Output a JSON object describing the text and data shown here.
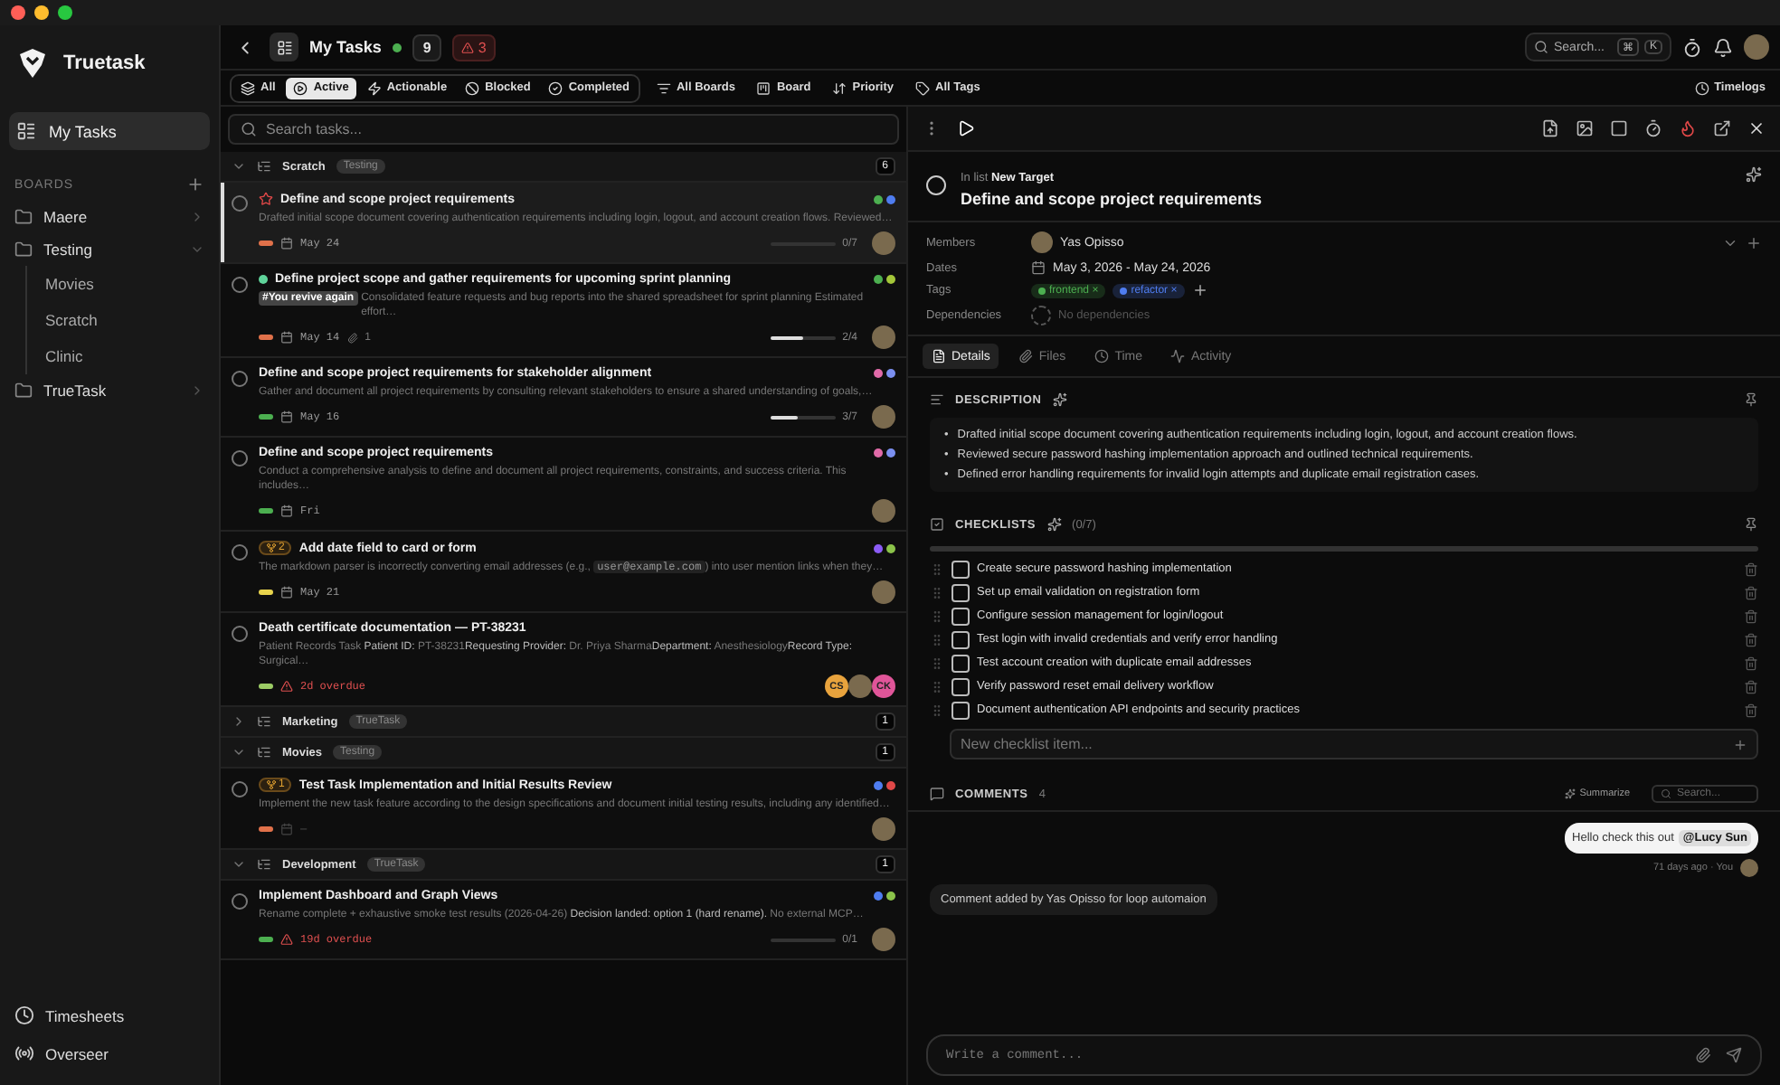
{
  "sidebar": {
    "brand": "Truetask",
    "nav": [
      {
        "label": "My Tasks",
        "selected": true
      }
    ],
    "boards_label": "BOARDS",
    "boards": [
      {
        "label": "Maere",
        "expanded": false
      },
      {
        "label": "Testing",
        "expanded": true,
        "children": [
          {
            "label": "Movies"
          },
          {
            "label": "Scratch"
          },
          {
            "label": "Clinic"
          }
        ]
      },
      {
        "label": "TrueTask",
        "expanded": false
      }
    ],
    "footer": [
      {
        "kind": "timesheets",
        "label": "Timesheets"
      },
      {
        "kind": "overseer",
        "label": "Overseer"
      }
    ]
  },
  "header": {
    "title": "My Tasks",
    "active_count": "9",
    "alert_count": "3",
    "search_placeholder": "Search...",
    "shortcut": [
      "⌘",
      "K"
    ]
  },
  "filters": [
    {
      "kind": "all",
      "label": "All",
      "selected": false
    },
    {
      "kind": "active",
      "label": "Active",
      "selected": true
    },
    {
      "kind": "actionable",
      "label": "Actionable",
      "selected": false
    },
    {
      "kind": "blocked",
      "label": "Blocked",
      "selected": false
    },
    {
      "kind": "completed",
      "label": "Completed",
      "selected": false
    }
  ],
  "views": [
    {
      "kind": "boards",
      "label": "All Boards"
    },
    {
      "kind": "board",
      "label": "Board"
    },
    {
      "kind": "priority",
      "label": "Priority"
    },
    {
      "kind": "tags",
      "label": "All Tags"
    }
  ],
  "timelogs": "Timelogs",
  "task_search": {
    "placeholder": "Search tasks..."
  },
  "groups": [
    {
      "name": "Scratch",
      "board": "Testing",
      "count": "6",
      "expanded": true,
      "tasks": [
        {
          "title": "Define and scope project requirements",
          "completed": false,
          "flagged": true,
          "selected": true,
          "description": [
            {
              "kind": "text",
              "text": "Drafted initial scope document covering authentication requirements including login, logout, and account creation flows. Reviewed…"
            }
          ],
          "priority": {
            "color": "#e0714a"
          },
          "due": {
            "kind": "date",
            "text": "May 24"
          },
          "progress": {
            "level": 0,
            "reading": "0/7"
          },
          "dots": [
            {
              "color": "#4caf50"
            },
            {
              "color": "#4f7df0"
            }
          ],
          "assignees": [
            {
              "kind": "photo"
            }
          ]
        },
        {
          "title": "Define project scope and gather requirements for upcoming sprint planning",
          "completed": false,
          "flagged": false,
          "selected": false,
          "status": {
            "color": "#5fd39a"
          },
          "label": "#You revive again",
          "description": [
            {
              "kind": "text",
              "text": "Consolidated feature requests and bug reports into the shared spreadsheet for sprint planning Estimated effort…"
            }
          ],
          "priority": {
            "color": "#e0714a"
          },
          "due": {
            "kind": "date",
            "text": "May 14"
          },
          "attachments": "1",
          "progress": {
            "level": 0.5,
            "reading": "2/4"
          },
          "dots": [
            {
              "color": "#4caf50"
            },
            {
              "color": "#a4c639"
            }
          ],
          "assignees": [
            {
              "kind": "photo"
            }
          ]
        },
        {
          "title": "Define and scope project requirements for stakeholder alignment",
          "completed": false,
          "flagged": false,
          "selected": false,
          "description": [
            {
              "kind": "text",
              "text": "Gather and document all project requirements by consulting relevant stakeholders to ensure a shared understanding of goals,…"
            }
          ],
          "priority": {
            "color": "#4caf50"
          },
          "due": {
            "kind": "date",
            "text": "May 16"
          },
          "progress": {
            "level": 0.43,
            "reading": "3/7"
          },
          "dots": [
            {
              "color": "#e06aa8"
            },
            {
              "color": "#7b8ff0"
            }
          ],
          "assignees": [
            {
              "kind": "photo"
            }
          ]
        },
        {
          "title": "Define and scope project requirements",
          "completed": false,
          "flagged": false,
          "selected": false,
          "description": [
            {
              "kind": "text",
              "text": "Conduct a comprehensive analysis to define and document all project requirements, constraints, and success criteria. This includes…"
            }
          ],
          "priority": {
            "color": "#4caf50"
          },
          "due": {
            "kind": "date",
            "text": "Fri"
          },
          "dots": [
            {
              "color": "#e06aa8"
            },
            {
              "color": "#7b8ff0"
            }
          ],
          "assignees": [
            {
              "kind": "photo"
            }
          ]
        },
        {
          "title": "Add date field to card or form",
          "completed": false,
          "flagged": false,
          "selected": false,
          "subtasks": "2",
          "description": [
            {
              "kind": "text",
              "text": "The markdown parser is incorrectly converting email addresses (e.g., "
            },
            {
              "kind": "code",
              "text": "user@example.com"
            },
            {
              "kind": "text",
              "text": ") into user mention links when they…"
            }
          ],
          "priority": {
            "color": "#e8d44d"
          },
          "due": {
            "kind": "date",
            "text": "May 21"
          },
          "dots": [
            {
              "color": "#8b5cf6"
            },
            {
              "color": "#8bc34a"
            }
          ],
          "assignees": [
            {
              "kind": "photo"
            }
          ]
        },
        {
          "title": "Death certificate documentation — PT-38231",
          "completed": false,
          "flagged": false,
          "selected": false,
          "description": [
            {
              "kind": "text",
              "text": "Patient Records Task **Patient ID:** PT-38231**Requesting Provider:** Dr. Priya Sharma**Department:** Anesthesiology**Record Type:** Surgical…"
            }
          ],
          "priority": {
            "color": "#9ccc65"
          },
          "due": {
            "kind": "overdue",
            "text": "2d overdue"
          },
          "assignees": [
            {
              "kind": "initials",
              "initials": "CS",
              "color": "#e8a33d"
            },
            {
              "kind": "photo"
            },
            {
              "kind": "initials",
              "initials": "CK",
              "color": "#e05599"
            }
          ]
        }
      ]
    },
    {
      "name": "Marketing",
      "board": "TrueTask",
      "count": "1",
      "expanded": false
    },
    {
      "name": "Movies",
      "board": "Testing",
      "count": "1",
      "expanded": true,
      "tasks": [
        {
          "title": "Test Task Implementation and Initial Results Review",
          "completed": false,
          "flagged": false,
          "selected": false,
          "subtasks": "1",
          "description": [
            {
              "kind": "text",
              "text": "Implement the new task feature according to the design specifications and document initial testing results, including any identified…"
            }
          ],
          "priority": {
            "color": "#e0714a"
          },
          "due": {
            "kind": "none",
            "text": "—"
          },
          "dots": [
            {
              "color": "#4f7df0"
            },
            {
              "color": "#e04848"
            }
          ],
          "assignees": [
            {
              "kind": "photo"
            }
          ]
        }
      ]
    },
    {
      "name": "Development",
      "board": "TrueTask",
      "count": "1",
      "expanded": true,
      "tasks": [
        {
          "title": "Implement Dashboard and Graph Views",
          "completed": false,
          "flagged": false,
          "selected": false,
          "description": [
            {
              "kind": "text",
              "text": "Rename complete + exhaustive smoke test results (2026-04-26) **Decision landed: option 1 (hard rename).** No external MCP…"
            }
          ],
          "priority": {
            "color": "#4caf50"
          },
          "due": {
            "kind": "overdue",
            "text": "19d overdue"
          },
          "progress": {
            "level": 0,
            "reading": "0/1"
          },
          "dots": [
            {
              "color": "#4f7df0"
            },
            {
              "color": "#8bc34a"
            }
          ],
          "assignees": [
            {
              "kind": "photo"
            }
          ]
        }
      ]
    }
  ],
  "detail": {
    "completed": false,
    "list_prefix": "In list",
    "list_name": "New Target",
    "title": "Define and scope project requirements",
    "fields": {
      "members_label": "Members",
      "member": "Yas Opisso",
      "dates_label": "Dates",
      "dates": "May 3, 2026 - May 24, 2026",
      "tags_label": "Tags",
      "tags": [
        {
          "label": "frontend",
          "remove": "×",
          "color": "#4caf50"
        },
        {
          "label": "refactor",
          "remove": "×",
          "color": "#4f7df0"
        }
      ],
      "dependencies_label": "Dependencies",
      "dependencies": "No dependencies"
    },
    "tabs": [
      {
        "kind": "details",
        "label": "Details",
        "selected": true
      },
      {
        "kind": "files",
        "label": "Files",
        "selected": false
      },
      {
        "kind": "time",
        "label": "Time",
        "selected": false
      },
      {
        "kind": "activity",
        "label": "Activity",
        "selected": false
      }
    ],
    "description": {
      "heading": "DESCRIPTION",
      "marker": "•",
      "bullets": [
        "Drafted initial scope document covering authentication requirements including login, logout, and account creation flows.",
        "Reviewed secure password hashing implementation approach and outlined technical requirements.",
        "Defined error handling requirements for invalid login attempts and duplicate email registration cases."
      ]
    },
    "checklist": {
      "heading": "CHECKLISTS",
      "summary": "(0/7)",
      "level": 0,
      "items": [
        {
          "text": "Create secure password hashing implementation",
          "checked": false
        },
        {
          "text": "Set up email validation on registration form",
          "checked": false
        },
        {
          "text": "Configure session management for login/logout",
          "checked": false
        },
        {
          "text": "Test login with invalid credentials and verify error handling",
          "checked": false
        },
        {
          "text": "Test account creation with duplicate email addresses",
          "checked": false
        },
        {
          "text": "Verify password reset email delivery workflow",
          "checked": false
        },
        {
          "text": "Document authentication API endpoints and security practices",
          "checked": false
        }
      ],
      "placeholder": "New checklist item..."
    },
    "comments": {
      "heading": "COMMENTS",
      "count": "4",
      "summarize": "Summarize",
      "search_placeholder": "Search...",
      "items": [
        {
          "kind": "own",
          "text": "Hello check this out",
          "mention": "@Lucy Sun",
          "time": "71 days ago",
          "separator": "·",
          "author": "You"
        },
        {
          "kind": "system",
          "text": "Comment added by Yas Opisso for loop automaion"
        }
      ],
      "composer_placeholder": "Write a comment..."
    }
  }
}
